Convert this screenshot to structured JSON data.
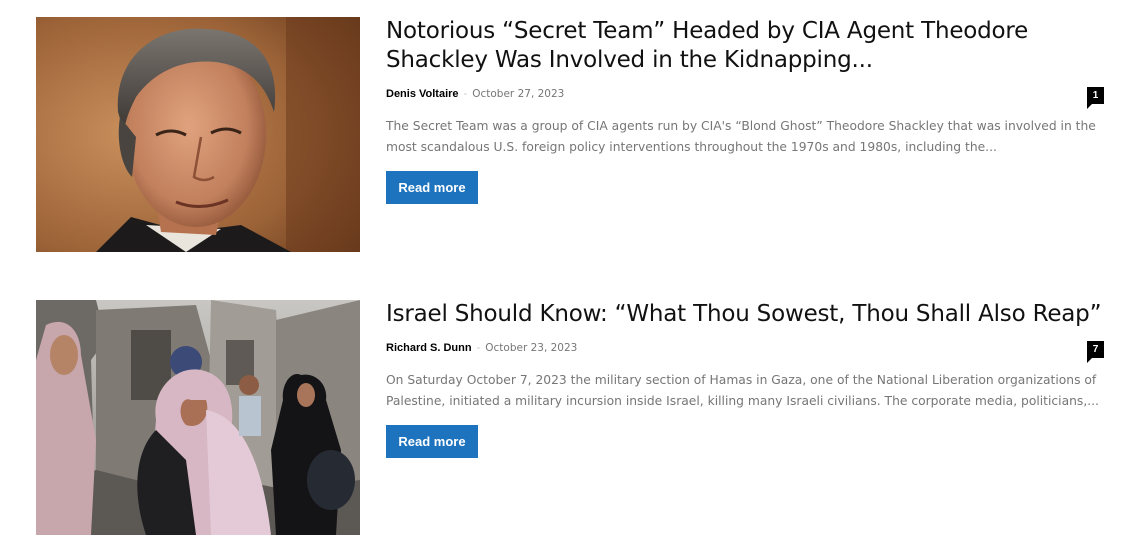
{
  "articles": [
    {
      "title": "Notorious “Secret Team” Headed by CIA Agent Theodore Shackley Was Involved in the Kidnapping...",
      "author": "Denis Voltaire",
      "separator": "-",
      "date": "October 27, 2023",
      "comment_count": "1",
      "excerpt": "The Secret Team was a group of CIA agents run by CIA's “Blond Ghost” Theodore Shackley that was involved in the most scandalous U.S. foreign policy interventions throughout the 1970s and 1980s, including the...",
      "read_more": "Read more",
      "thumbnail": "portrait-photo"
    },
    {
      "title": "Israel Should Know: “What Thou Sowest, Thou Shall Also Reap”",
      "author": "Richard S. Dunn",
      "separator": "-",
      "date": "October 23, 2023",
      "comment_count": "7",
      "excerpt": "On Saturday October 7, 2023 the military section of Hamas in Gaza, one of the National Liberation organizations of Palestine, initiated a military incursion inside Israel, killing many Israeli civilians. The corporate media, politicians,...",
      "read_more": "Read more",
      "thumbnail": "street-scene-photo"
    }
  ],
  "colors": {
    "accent": "#1e73be",
    "title": "#111111",
    "meta": "#767676",
    "excerpt": "#767676",
    "comment_badge": "#000000"
  }
}
